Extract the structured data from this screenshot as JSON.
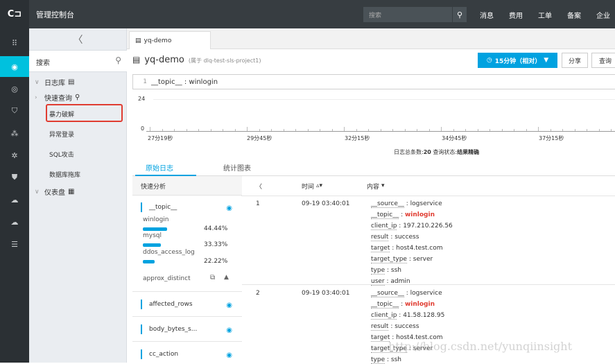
{
  "topbar": {
    "logo": "C⊐",
    "title": "管理控制台",
    "search_placeholder": "搜索",
    "nav": [
      "消息",
      "费用",
      "工单",
      "备案",
      "企业"
    ]
  },
  "sidebar": {
    "search_label": "搜索",
    "logstore": "日志库",
    "quick_query": "快速查询",
    "queries": [
      "暴力破解",
      "异常登录",
      "SQL攻击",
      "数据库拖库"
    ],
    "dashboard": "仪表盘"
  },
  "tab": {
    "label": "yq-demo"
  },
  "logstore_header": {
    "name": "yq-demo",
    "project": "(属于 dlq-test-sls-project1)",
    "time_range": "15分钟（相对）",
    "share": "分享",
    "query": "查询"
  },
  "query": {
    "line": "1",
    "text": "__topic__ : winlogin"
  },
  "histogram": {
    "y_max": "24",
    "y_min": "0",
    "x_labels": [
      "27分19秒",
      "29分45秒",
      "32分15秒",
      "34分45秒",
      "37分15秒"
    ]
  },
  "summary": {
    "count_label": "日志总条数:",
    "count": "20",
    "status_label": "查询状态:",
    "status": "结果精确"
  },
  "result_tabs": [
    "原始日志",
    "统计图表"
  ],
  "fields_panel": {
    "title": "快速分析",
    "topic_field": "__topic__",
    "topic_values": [
      {
        "name": "winlogin",
        "pct": "44.44%",
        "ratio": 0.4444
      },
      {
        "name": "mysql",
        "pct": "33.33%",
        "ratio": 0.3333
      },
      {
        "name": "ddos_access_log",
        "pct": "22.22%",
        "ratio": 0.2222
      }
    ],
    "approx_distinct": "approx_distinct",
    "other_fields": [
      "affected_rows",
      "body_bytes_s...",
      "cc_action"
    ]
  },
  "table": {
    "col_time": "时间",
    "col_content": "内容",
    "rows": [
      {
        "num": "1",
        "time": "09-19 03:40:01",
        "fields": [
          {
            "k": "__source__",
            "v": "logservice",
            "hl": false
          },
          {
            "k": "__topic__",
            "v": "winlogin",
            "hl": true
          },
          {
            "k": "client_ip",
            "v": "197.210.226.56",
            "hl": false
          },
          {
            "k": "result",
            "v": "success",
            "hl": false
          },
          {
            "k": "target",
            "v": "host4.test.com",
            "hl": false
          },
          {
            "k": "target_type",
            "v": "server",
            "hl": false
          },
          {
            "k": "type",
            "v": "ssh",
            "hl": false
          },
          {
            "k": "user",
            "v": "admin",
            "hl": false
          }
        ]
      },
      {
        "num": "2",
        "time": "09-19 03:40:01",
        "fields": [
          {
            "k": "__source__",
            "v": "logservice",
            "hl": false
          },
          {
            "k": "__topic__",
            "v": "winlogin",
            "hl": true
          },
          {
            "k": "client_ip",
            "v": "41.58.128.95",
            "hl": false
          },
          {
            "k": "result",
            "v": "success",
            "hl": false
          },
          {
            "k": "target",
            "v": "host4.test.com",
            "hl": false
          },
          {
            "k": "target_type",
            "v": "server",
            "hl": false
          },
          {
            "k": "type",
            "v": "ssh",
            "hl": false
          }
        ]
      }
    ]
  },
  "watermark": "http://blog.csdn.net/yunqiinsight"
}
